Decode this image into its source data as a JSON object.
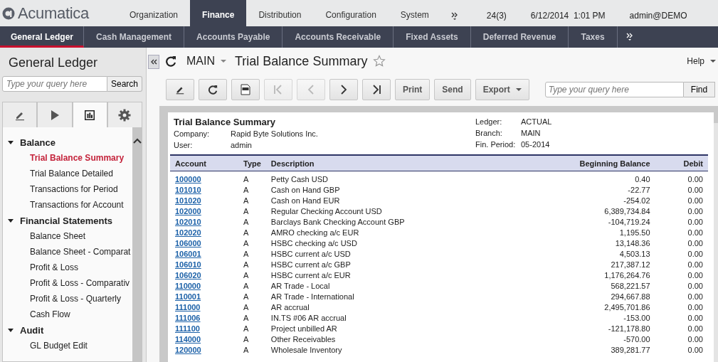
{
  "header": {
    "logo": "Acumatica",
    "tabs": [
      {
        "label": "Organization",
        "selected": false
      },
      {
        "label": "Finance",
        "selected": true
      },
      {
        "label": "Distribution",
        "selected": false
      },
      {
        "label": "Configuration",
        "selected": false
      },
      {
        "label": "System",
        "selected": false
      }
    ],
    "notifications": "24(3)",
    "datetime": "6/12/2014  1:01 PM",
    "user": "admin@DEMO"
  },
  "modules": [
    {
      "label": "General Ledger",
      "selected": true
    },
    {
      "label": "Cash Management",
      "selected": false
    },
    {
      "label": "Accounts Payable",
      "selected": false
    },
    {
      "label": "Accounts Receivable",
      "selected": false
    },
    {
      "label": "Fixed Assets",
      "selected": false
    },
    {
      "label": "Deferred Revenue",
      "selected": false
    },
    {
      "label": "Taxes",
      "selected": false
    }
  ],
  "sidebar": {
    "title": "General Ledger",
    "search": {
      "placeholder": "Type your query here",
      "button": "Search"
    },
    "tabs": [
      {
        "kind": "edit",
        "selected": false
      },
      {
        "kind": "run",
        "selected": false
      },
      {
        "kind": "report",
        "selected": true
      },
      {
        "kind": "settings",
        "selected": false
      }
    ],
    "groups": [
      {
        "label": "Balance",
        "expanded": true,
        "children": [
          {
            "label": "Trial Balance Summary",
            "selected": true
          },
          {
            "label": "Trial Balance Detailed",
            "selected": false
          },
          {
            "label": "Transactions for Period",
            "selected": false
          },
          {
            "label": "Transactions for Account",
            "selected": false
          }
        ]
      },
      {
        "label": "Financial Statements",
        "expanded": true,
        "children": [
          {
            "label": "Balance Sheet",
            "selected": false
          },
          {
            "label": "Balance Sheet - Comparat",
            "selected": false
          },
          {
            "label": "Profit & Loss",
            "selected": false
          },
          {
            "label": "Profit & Loss - Comparativ",
            "selected": false
          },
          {
            "label": "Profit & Loss - Quarterly",
            "selected": false
          },
          {
            "label": "Cash Flow",
            "selected": false
          }
        ]
      },
      {
        "label": "Audit",
        "expanded": true,
        "children": [
          {
            "label": "GL Budget Edit",
            "selected": false
          }
        ]
      }
    ]
  },
  "page": {
    "company_branch": "MAIN",
    "title": "Trial Balance Summary",
    "help": "Help",
    "toolbar": [
      {
        "kind": "edit",
        "disabled": false
      },
      {
        "kind": "refresh",
        "disabled": false
      },
      {
        "kind": "pdf",
        "disabled": false
      },
      {
        "kind": "first",
        "disabled": true
      },
      {
        "kind": "prev",
        "disabled": true
      },
      {
        "kind": "next",
        "disabled": false
      },
      {
        "kind": "last",
        "disabled": false
      },
      {
        "kind": "text",
        "label": "Print",
        "disabled": false
      },
      {
        "kind": "text",
        "label": "Send",
        "disabled": false
      },
      {
        "kind": "menu",
        "label": "Export",
        "disabled": false
      }
    ],
    "find": {
      "placeholder": "Type your query here",
      "button": "Find"
    }
  },
  "report": {
    "title": "Trial Balance Summary",
    "info_left": [
      {
        "label": "Company:",
        "value": "Rapid Byte Solutions Inc."
      },
      {
        "label": "User:",
        "value": "admin"
      }
    ],
    "info_right": [
      {
        "label": "Ledger:",
        "value": "ACTUAL"
      },
      {
        "label": "Branch:",
        "value": "MAIN"
      },
      {
        "label": "Fin. Period:",
        "value": "05-2014"
      }
    ],
    "columns": [
      "Account",
      "Type",
      "Description",
      "Beginning Balance",
      "Debit"
    ],
    "rows": [
      [
        "100000",
        "A",
        "Petty Cash USD",
        "0.40",
        "0.00"
      ],
      [
        "101010",
        "A",
        "Cash on Hand GBP",
        "-22.77",
        "0.00"
      ],
      [
        "101020",
        "A",
        "Cash on Hand EUR",
        "-254.02",
        "0.00"
      ],
      [
        "102000",
        "A",
        "Regular Checking Account USD",
        "6,389,734.84",
        "0.00"
      ],
      [
        "102010",
        "A",
        "Barclays Bank Checking Account GBP",
        "-104,719.24",
        "0.00"
      ],
      [
        "102020",
        "A",
        "AMRO checking a/c EUR",
        "1,195.50",
        "0.00"
      ],
      [
        "106000",
        "A",
        "HSBC checking a/c USD",
        "13,148.36",
        "0.00"
      ],
      [
        "106001",
        "A",
        "HSBC current a/c USD",
        "4,503.13",
        "0.00"
      ],
      [
        "106010",
        "A",
        "HSBC current a/c GBP",
        "217,387.12",
        "0.00"
      ],
      [
        "106020",
        "A",
        "HSBC current a/c EUR",
        "1,176,264.76",
        "0.00"
      ],
      [
        "110000",
        "A",
        "AR Trade - Local",
        "568,221.57",
        "0.00"
      ],
      [
        "110001",
        "A",
        "AR Trade - International",
        "294,667.88",
        "0.00"
      ],
      [
        "111000",
        "A",
        "AR accrual",
        "2,495,701.86",
        "0.00"
      ],
      [
        "111006",
        "A",
        "IN.TS #06 AR accrual",
        "-153.00",
        "0.00"
      ],
      [
        "111100",
        "A",
        "Project unbilled AR",
        "-121,178.80",
        "0.00"
      ],
      [
        "114000",
        "A",
        "Other Receivables",
        "-570.00",
        "0.00"
      ],
      [
        "120000",
        "A",
        "Wholesale Inventory",
        "389,281.77",
        "0.00"
      ]
    ]
  }
}
